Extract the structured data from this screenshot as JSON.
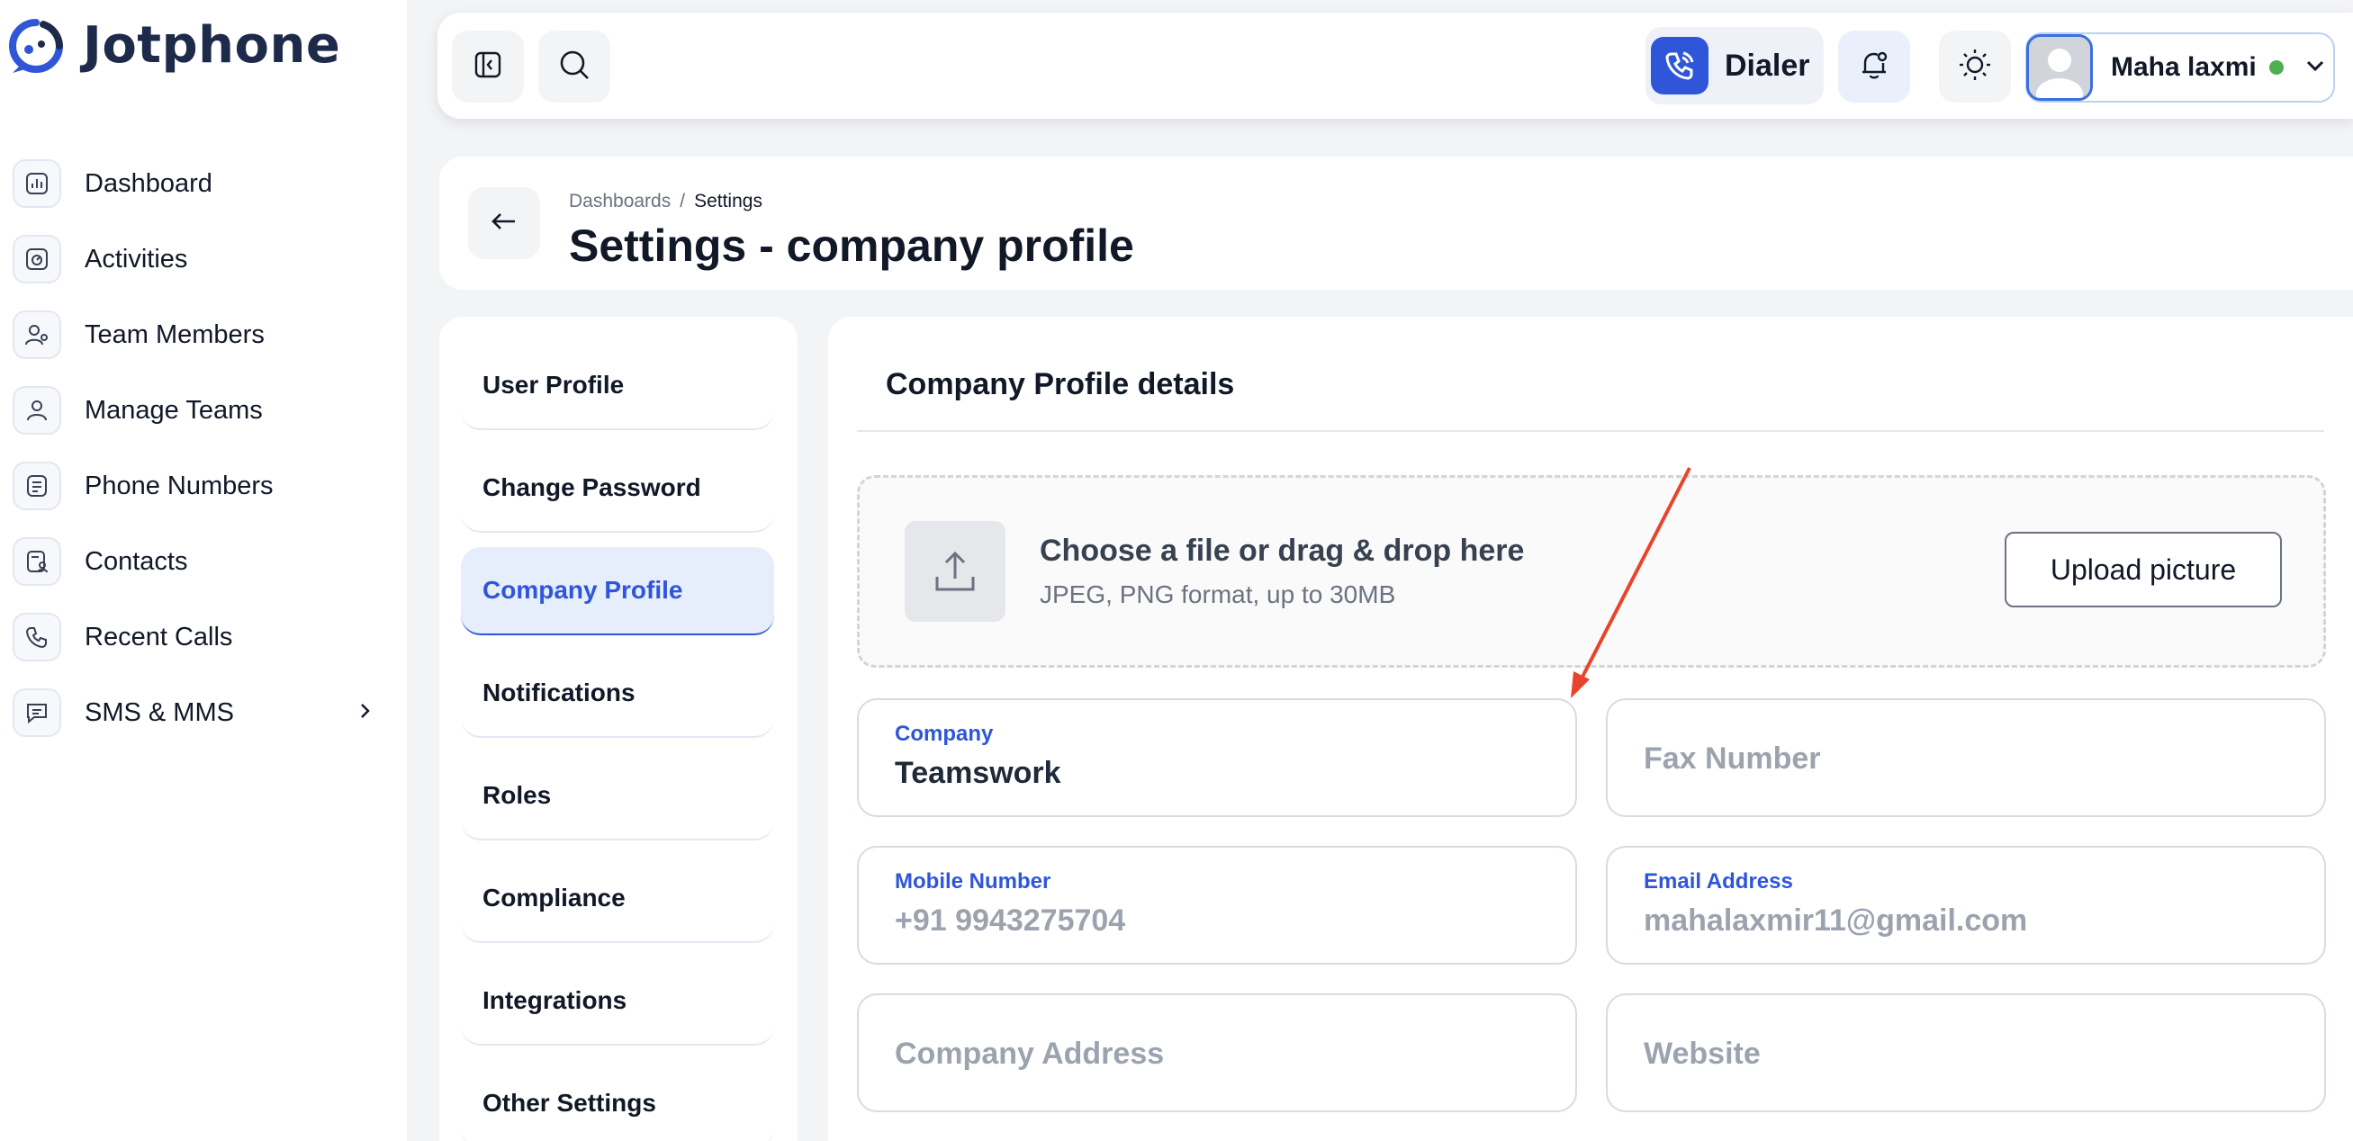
{
  "brand": {
    "name": "Jotphone"
  },
  "sidebar": {
    "items": [
      {
        "label": "Dashboard",
        "icon": "chart-icon"
      },
      {
        "label": "Activities",
        "icon": "activity-icon"
      },
      {
        "label": "Team Members",
        "icon": "team-members-icon"
      },
      {
        "label": "Manage Teams",
        "icon": "manage-teams-icon"
      },
      {
        "label": "Phone Numbers",
        "icon": "phone-numbers-icon"
      },
      {
        "label": "Contacts",
        "icon": "contacts-icon"
      },
      {
        "label": "Recent Calls",
        "icon": "phone-call-icon"
      },
      {
        "label": "SMS & MMS",
        "icon": "message-icon",
        "has_submenu": true
      }
    ]
  },
  "topbar": {
    "dialer_label": "Dialer",
    "user": {
      "name": "Maha laxmi",
      "status": "online",
      "status_color": "#4caf50"
    },
    "accent_color": "#2f56d8"
  },
  "header": {
    "breadcrumb": [
      "Dashboards",
      "Settings"
    ],
    "breadcrumb_separator": "/",
    "title": "Settings - company profile"
  },
  "settings_menu": {
    "items": [
      {
        "label": "User Profile"
      },
      {
        "label": "Change Password"
      },
      {
        "label": "Company Profile",
        "active": true
      },
      {
        "label": "Notifications"
      },
      {
        "label": "Roles"
      },
      {
        "label": "Compliance"
      },
      {
        "label": "Integrations"
      },
      {
        "label": "Other Settings"
      }
    ]
  },
  "company_profile": {
    "section_title": "Company Profile details",
    "upload": {
      "title": "Choose a file or drag & drop here",
      "subtitle": "JPEG, PNG format, up to 30MB",
      "button_label": "Upload picture"
    },
    "fields": {
      "company": {
        "label": "Company",
        "value": "Teamswork"
      },
      "fax_number": {
        "placeholder": "Fax Number"
      },
      "mobile_number": {
        "label": "Mobile Number",
        "value": "+91 9943275704"
      },
      "email_address": {
        "label": "Email Address",
        "value": "mahalaxmir11@gmail.com"
      },
      "company_address": {
        "placeholder": "Company Address"
      },
      "website": {
        "placeholder": "Website"
      }
    }
  },
  "annotation": {
    "arrow_color": "#e8442b"
  }
}
